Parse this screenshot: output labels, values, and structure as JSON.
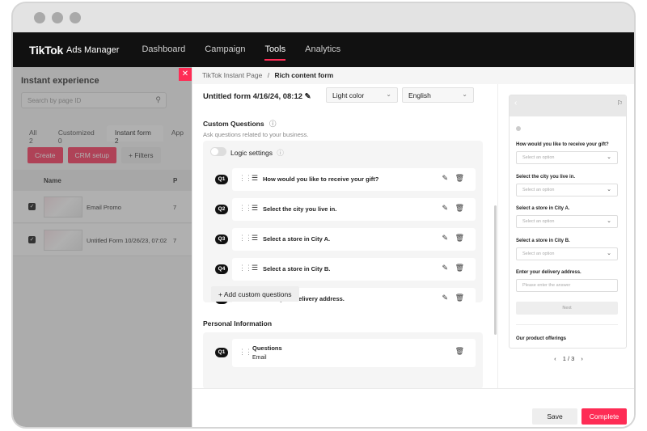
{
  "nav": {
    "logo": "TikTok",
    "logo_sub": "Ads Manager",
    "items": [
      "Dashboard",
      "Campaign",
      "Tools",
      "Analytics"
    ]
  },
  "left": {
    "title": "Instant experience",
    "search_placeholder": "Search by page ID",
    "tabs": [
      "All 2",
      "Customized 0",
      "Instant form 2",
      "App"
    ],
    "create": "Create",
    "crm": "CRM setup",
    "filters": "Filters",
    "col_name": "Name",
    "col_p": "P",
    "rows": [
      {
        "name": "Email Promo",
        "val": "7"
      },
      {
        "name": "Untitled Form 10/26/23, 07:02",
        "val": "7"
      }
    ]
  },
  "drawer": {
    "breadcrumb_parent": "TikTok Instant Page",
    "breadcrumb_sep": "/",
    "breadcrumb_current": "Rich content form",
    "form_title": "Untitled form 4/16/24, 08:12",
    "theme_select": "Light color",
    "language_select": "English",
    "custom_title": "Custom Questions",
    "custom_sub": "Ask questions related to your business.",
    "logic_label": "Logic settings",
    "questions": [
      {
        "badge": "Q1",
        "text": "How would you like to receive your gift?"
      },
      {
        "badge": "Q2",
        "text": "Select the city you live in."
      },
      {
        "badge": "Q3",
        "text": "Select a store in City A."
      },
      {
        "badge": "Q4",
        "text": "Select a store in City B."
      },
      {
        "badge": "Q5",
        "text": "Enter your delivery address."
      }
    ],
    "add_question": "Add custom questions",
    "personal_title": "Personal Information",
    "personal_q": {
      "badge": "Q1",
      "title": "Questions",
      "sub": "Email"
    }
  },
  "preview": {
    "fields": [
      {
        "label": "How would you like to receive your gift?",
        "placeholder": "Select an option"
      },
      {
        "label": "Select the city you live in.",
        "placeholder": "Select an option"
      },
      {
        "label": "Select a store in City A.",
        "placeholder": "Select an option"
      },
      {
        "label": "Select a store in City B.",
        "placeholder": "Select an option"
      },
      {
        "label": "Enter your delivery address.",
        "placeholder": "Please enter the answer"
      }
    ],
    "next": "Next",
    "offerings": "Our product offerings",
    "pager": "1 / 3"
  },
  "footer": {
    "save": "Save",
    "complete": "Complete"
  },
  "colors": {
    "accent": "#fe2c55",
    "nav_bg": "#111111"
  }
}
